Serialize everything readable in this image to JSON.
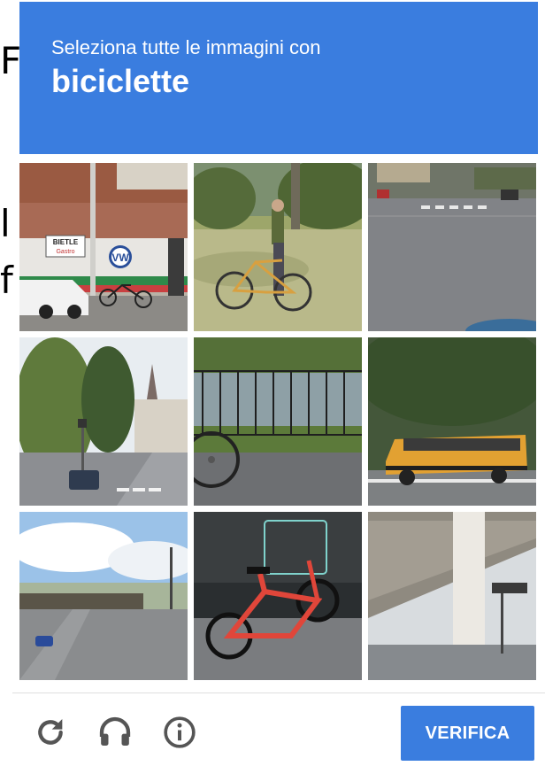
{
  "background_fragments": [
    "F",
    "l",
    "f"
  ],
  "challenge": {
    "instruction": "Seleziona tutte le immagini con",
    "keyword": "biciclette",
    "header_color": "#3a7ddf"
  },
  "tiles": [
    {
      "row": 1,
      "col": 1,
      "scene": "street storefront with bicycle and parked car",
      "sign_text": "BIETLE",
      "sign_subtext": "Gastro"
    },
    {
      "row": 1,
      "col": 2,
      "scene": "person with bicycle in park"
    },
    {
      "row": 1,
      "col": 3,
      "scene": "road intersection"
    },
    {
      "row": 2,
      "col": 1,
      "scene": "town street with church spire"
    },
    {
      "row": 2,
      "col": 2,
      "scene": "bicycle wheel by fence and river"
    },
    {
      "row": 2,
      "col": 3,
      "scene": "yellow school bus on road"
    },
    {
      "row": 3,
      "col": 1,
      "scene": "highway overpass under blue sky"
    },
    {
      "row": 3,
      "col": 2,
      "scene": "red folding bicycle"
    },
    {
      "row": 3,
      "col": 3,
      "scene": "underside of concrete overpass"
    }
  ],
  "footer": {
    "reload_icon": "reload-icon",
    "audio_icon": "headphones-icon",
    "info_icon": "info-icon",
    "verify_label": "VERIFICA",
    "accent_color": "#3a7ddf"
  }
}
